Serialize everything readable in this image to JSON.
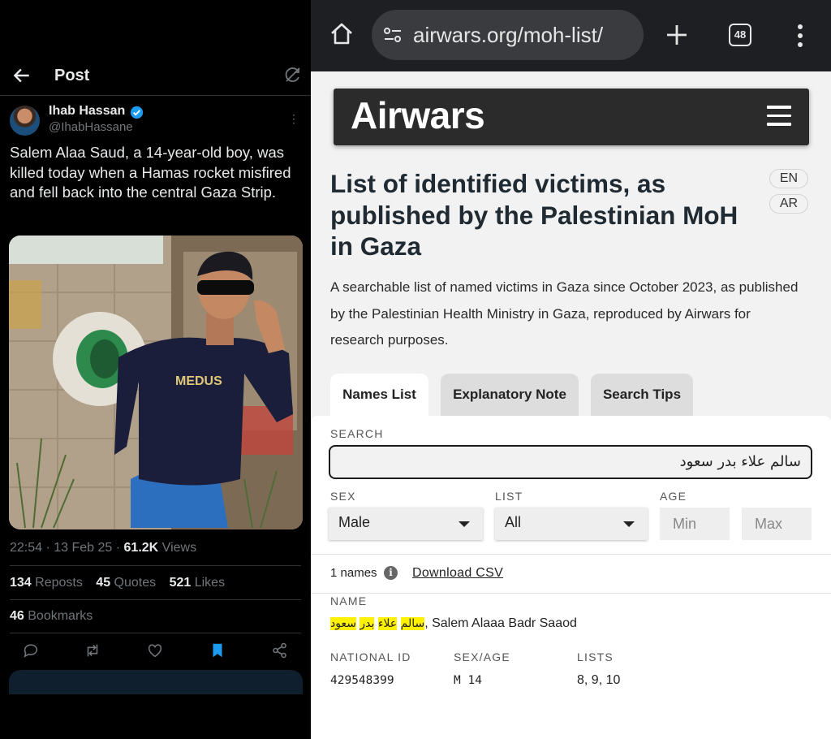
{
  "x_post": {
    "header_title": "Post",
    "author": {
      "name": "Ihab Hassan",
      "handle": "@IhabHassane"
    },
    "text": "Salem Alaa Saud, a 14-year-old boy, was killed today when a Hamas rocket misfired and fell back into the central Gaza Strip.",
    "photo_logo_text": "MEDUS",
    "time": "22:54 · 13 Feb 25 · ",
    "views_count": "61.2K",
    "views_label": " Views",
    "reposts_count": "134",
    "reposts_label": " Reposts",
    "quotes_count": "45",
    "quotes_label": " Quotes",
    "likes_count": "521",
    "likes_label": " Likes",
    "bookmarks_count": "46",
    "bookmarks_label": " Bookmarks",
    "action_icons": [
      "reply-icon",
      "repost-icon",
      "like-icon",
      "bookmark-icon",
      "share-icon"
    ],
    "colors": {
      "accent": "#1d9bf0",
      "muted": "#71767b"
    }
  },
  "browser": {
    "url": "airwars.org/moh-list/",
    "tab_count": "48"
  },
  "site": {
    "logo": "Airwars",
    "title": "List of identified victims, as published by the Palestinian MoH in Gaza",
    "lang_en": "EN",
    "lang_ar": "AR",
    "intro": "A searchable list of named victims in Gaza since October 2023, as published by the Palestinian Health Ministry in Gaza, reproduced by Airwars for research purposes.",
    "tabs": [
      {
        "label": "Names List",
        "active": true
      },
      {
        "label": "Explanatory Note",
        "active": false
      },
      {
        "label": "Search Tips",
        "active": false
      }
    ],
    "filters": {
      "search_label": "SEARCH",
      "search_value": "سالم علاء بدر سعود",
      "sex_label": "SEX",
      "sex_value": "Male",
      "list_label": "LIST",
      "list_value": "All",
      "age_label": "AGE",
      "age_min_placeholder": "Min",
      "age_max_placeholder": "Max"
    },
    "results": {
      "count_text": "1 names",
      "download_label": "Download CSV",
      "name_label": "NAME",
      "name_hl_1": "سالم",
      "name_hl_2": "علاء",
      "name_hl_3": "بدر",
      "name_hl_4": "سعود",
      "name_latin": ", Salem Alaaa Badr Saaod",
      "national_id_label": "NATIONAL ID",
      "national_id": "429548399",
      "sex_age_label": "SEX/AGE",
      "sex_age": "M 14",
      "lists_label": "LISTS",
      "lists": "8, 9, 10"
    }
  }
}
